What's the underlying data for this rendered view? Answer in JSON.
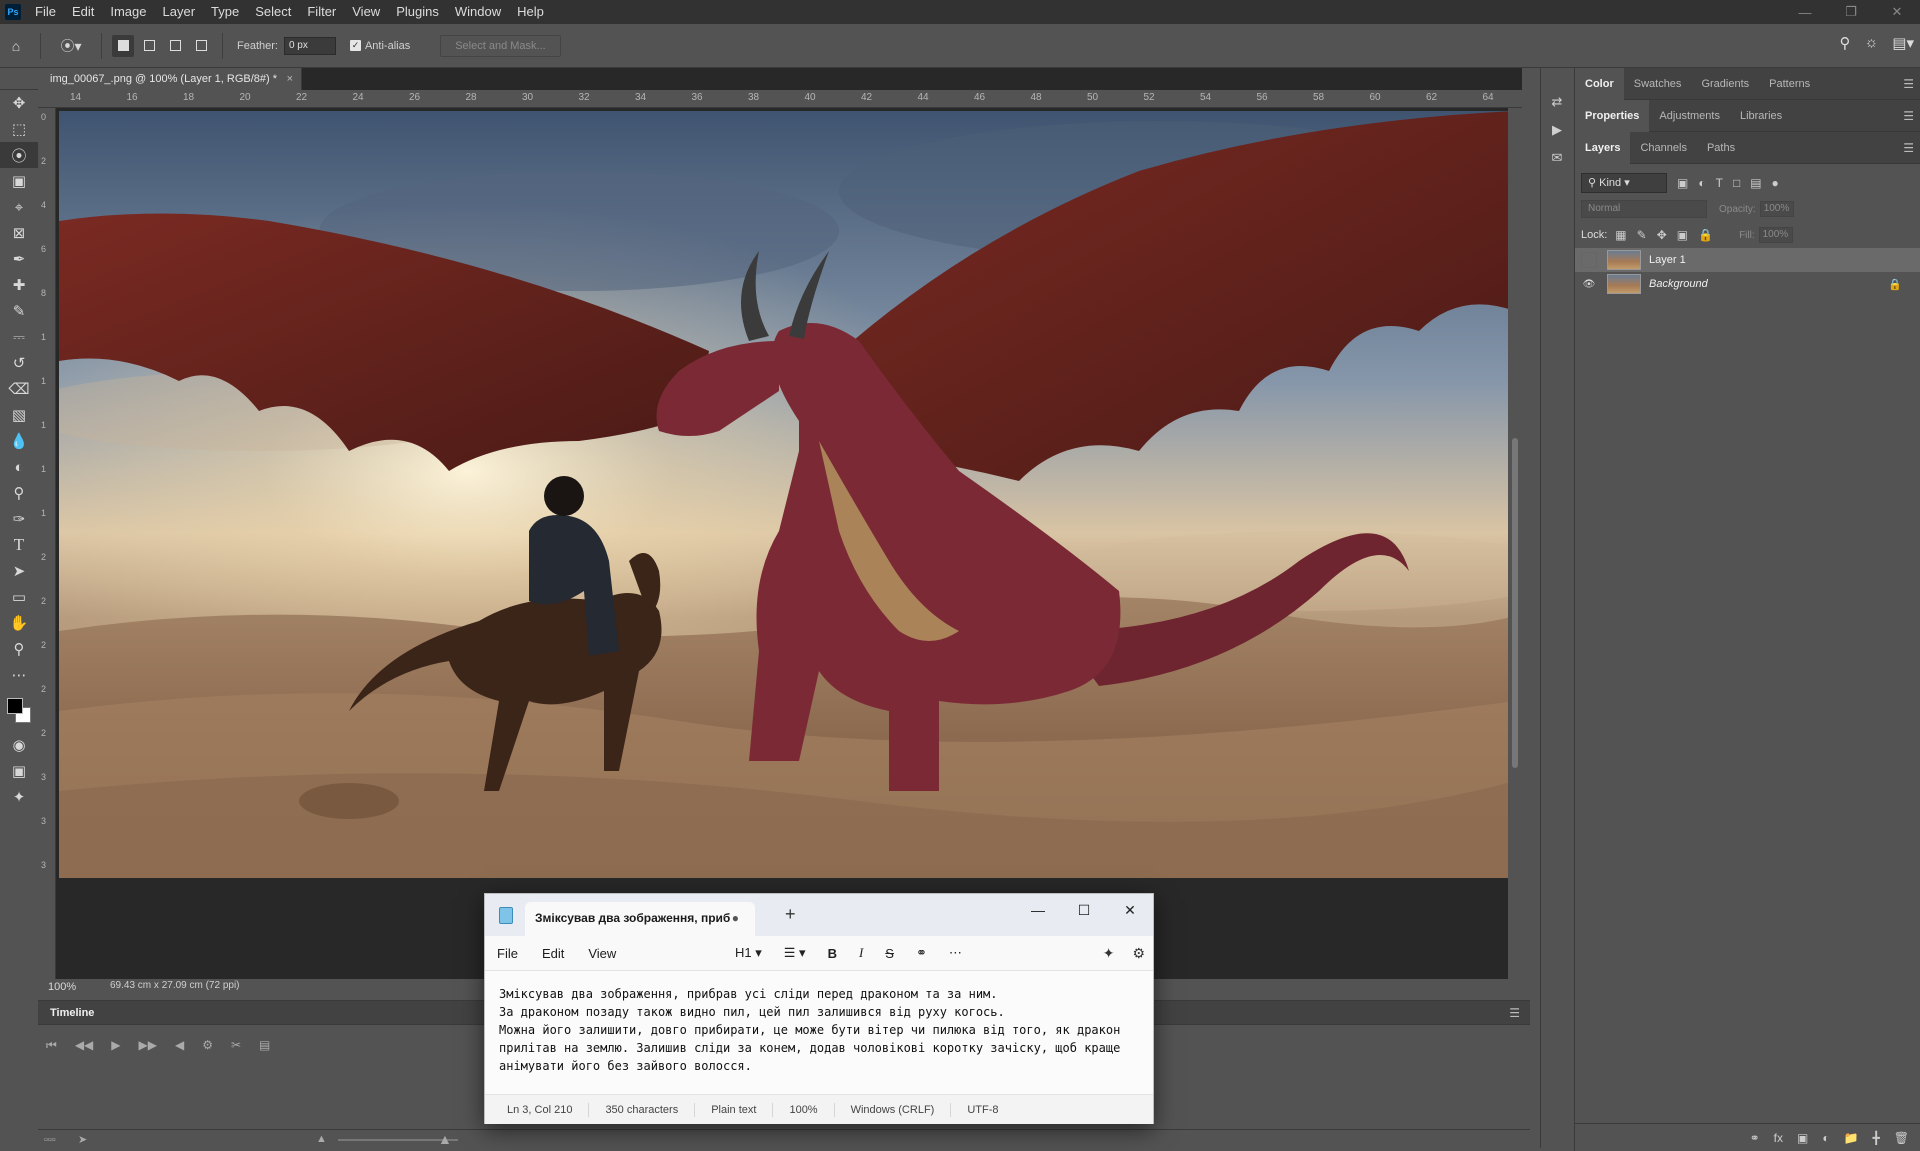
{
  "menubar": {
    "logo": "Ps",
    "items": [
      "File",
      "Edit",
      "Image",
      "Layer",
      "Type",
      "Select",
      "Filter",
      "View",
      "Plugins",
      "Window",
      "Help"
    ]
  },
  "options": {
    "feather_label": "Feather:",
    "feather_value": "0 px",
    "antialias_label": "Anti-alias",
    "select_mask_label": "Select and Mask..."
  },
  "document": {
    "tab_title": "img_00067_.png @ 100% (Layer 1, RGB/8#) *",
    "ruler_h": [
      "14",
      "16",
      "18",
      "20",
      "22",
      "24",
      "26",
      "28",
      "30",
      "32",
      "34",
      "36",
      "38",
      "40",
      "42",
      "44",
      "46",
      "48",
      "50",
      "52",
      "54",
      "56",
      "58",
      "60",
      "62",
      "64"
    ],
    "ruler_v": [
      "0",
      "2",
      "4",
      "6",
      "8",
      "1",
      "1",
      "1",
      "1",
      "1",
      "2",
      "2",
      "2",
      "2",
      "2",
      "3",
      "3",
      "3"
    ],
    "zoom": "100%",
    "dimensions": "69.43 cm x 27.09 cm (72 ppi)"
  },
  "panels": {
    "tabs_row1": [
      "Color",
      "Swatches",
      "Gradients",
      "Patterns"
    ],
    "tabs_row2": [
      "Properties",
      "Adjustments",
      "Libraries"
    ],
    "tabs_row3": [
      "Layers",
      "Channels",
      "Paths"
    ],
    "kind_label": "Kind",
    "blend_mode": "Normal",
    "opacity_label": "Opacity:",
    "opacity_value": "100%",
    "lock_label": "Lock:",
    "fill_label": "Fill:",
    "fill_value": "100%",
    "layers": [
      {
        "name": "Layer 1",
        "visible": false,
        "selected": true
      },
      {
        "name": "Background",
        "visible": true,
        "selected": false
      }
    ]
  },
  "timeline": {
    "title": "Timeline"
  },
  "notepad": {
    "tab_title": "Зміксував два зображення, приб",
    "menu": [
      "File",
      "Edit",
      "View"
    ],
    "heading_label": "H1",
    "text": "Зміксував два зображення, прибрав усі сліди перед драконом та за ним.\nЗа драконом позаду також видно пил, цей пил залишився від руху когось.\nМожна його залишити, довго прибирати, це може бути вітер чи пилюка від того, як дракон прилітав на землю. Залишив сліди за конем, додав чоловікові коротку зачіску, щоб краще анімувати його без зайвого волосся.",
    "status": {
      "position": "Ln 3, Col 210",
      "chars": "350 characters",
      "format": "Plain text",
      "zoom": "100%",
      "line_endings": "Windows (CRLF)",
      "encoding": "UTF-8"
    }
  }
}
